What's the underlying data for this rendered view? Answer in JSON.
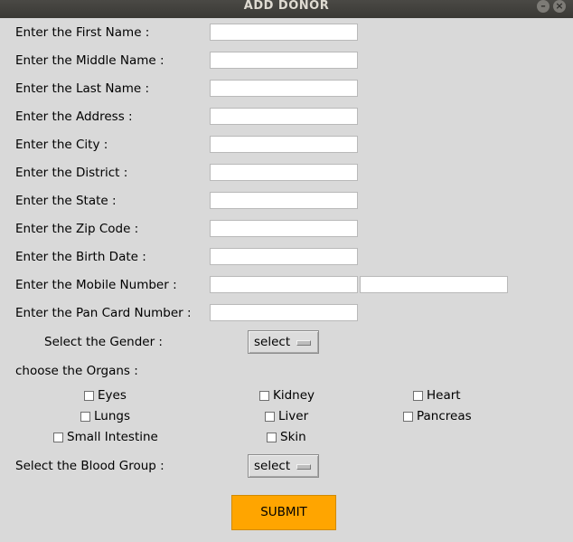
{
  "window": {
    "title": "ADD DONOR",
    "minimize_glyph": "–",
    "close_glyph": "×"
  },
  "form": {
    "first_name_label": "Enter the First Name :",
    "middle_name_label": "Enter the Middle Name :",
    "last_name_label": "Enter the Last Name :",
    "address_label": "Enter the Address :",
    "city_label": "Enter the City :",
    "district_label": "Enter the District :",
    "state_label": "Enter the State :",
    "zip_label": "Enter the Zip Code :",
    "birth_date_label": "Enter the Birth Date :",
    "mobile_label": "Enter the Mobile Number :",
    "pan_label": "Enter the Pan Card Number :",
    "gender_label": "Select the Gender :",
    "gender_value": "select",
    "organs_label": "choose the Organs :",
    "organs": {
      "eyes": "Eyes",
      "kidney": "Kidney",
      "heart": "Heart",
      "lungs": "Lungs",
      "liver": "Liver",
      "pancreas": "Pancreas",
      "small_intestine": "Small Intestine",
      "skin": "Skin"
    },
    "blood_group_label": "Select the Blood Group :",
    "blood_group_value": "select",
    "submit_label": "SUBMIT"
  },
  "colors": {
    "background": "#d9d9d9",
    "titlebar": "#3c3b37",
    "submit": "#ffa500"
  }
}
